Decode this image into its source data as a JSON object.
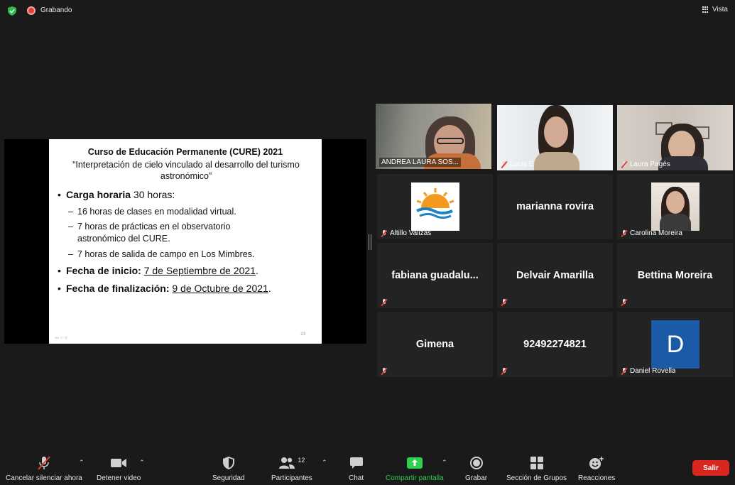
{
  "topbar": {
    "recording_label": "Grabando",
    "view_label": "Vista"
  },
  "slide": {
    "title": "Curso de Educación Permanente (CURE) 2021",
    "subtitle": "“Interpretación de cielo vinculado al desarrollo del turismo astronómico”",
    "carga_bold": "Carga horaria",
    "carga_rest": " 30 horas:",
    "sub_items": [
      "16 horas de clases en modalidad virtual.",
      "7 horas de prácticas en el observatorio astronómico del CURE.",
      "7 horas de salida de campo en Los Mimbres."
    ],
    "inicio_bold": "Fecha de inicio:",
    "inicio_value": "7 de Septiembre de 2021",
    "fin_bold": "Fecha de finalización:",
    "fin_value": "9 de Octubre de 2021",
    "period": ".",
    "page_number": "23"
  },
  "participants": [
    {
      "name": "ANDREA LAURA SOS...",
      "type": "video",
      "active_speaker": true,
      "muted": false
    },
    {
      "name": "Lucia E",
      "type": "video",
      "muted": true
    },
    {
      "name": "Laura Pagés",
      "type": "video",
      "muted": true
    },
    {
      "name": "Altillo Valizas",
      "type": "logo",
      "muted": true
    },
    {
      "name": "marianna rovira",
      "type": "text",
      "muted": false
    },
    {
      "name": "Carolina Moreira",
      "type": "photo",
      "muted": true
    },
    {
      "name": "fabiana guadalu...",
      "type": "text",
      "muted": true
    },
    {
      "name": "Delvair Amarilla",
      "type": "text",
      "muted": true
    },
    {
      "name": "Bettina Moreira",
      "type": "text",
      "muted": true
    },
    {
      "name": "Gimena",
      "type": "text",
      "muted": true
    },
    {
      "name": "92492274821",
      "type": "text",
      "muted": true
    },
    {
      "name": "Daniel Rovella",
      "type": "avatar",
      "avatar_letter": "D",
      "muted": true
    }
  ],
  "toolbar": {
    "unmute_label": "Cancelar silenciar ahora",
    "video_label": "Detener video",
    "security_label": "Seguridad",
    "participants_label": "Participantes",
    "participants_count": "12",
    "chat_label": "Chat",
    "share_label": "Compartir pantalla",
    "record_label": "Grabar",
    "breakout_label": "Sección de Grupos",
    "reactions_label": "Reacciones",
    "leave_label": "Salir"
  },
  "colors": {
    "active_speaker_border": "#bde06f",
    "share_green": "#2dd24f",
    "leave_red": "#d9271f",
    "muted_red": "#e0403a",
    "avatar_blue": "#1b5aa6"
  }
}
